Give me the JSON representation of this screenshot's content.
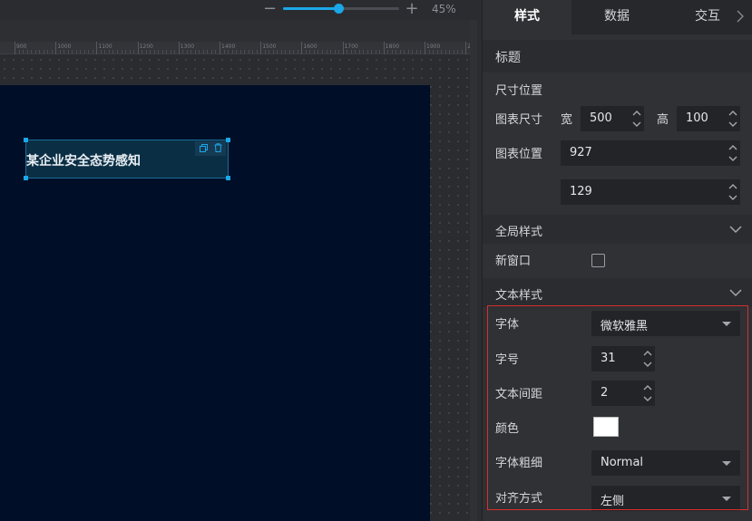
{
  "zoom": {
    "value_label": "45%",
    "percent": 45,
    "minus": "−",
    "plus": "+"
  },
  "ruler": {
    "labels": [
      "900",
      "1000",
      "1100",
      "1200",
      "1300",
      "1400",
      "1500",
      "1600",
      "1700",
      "1800",
      "1900",
      "20"
    ]
  },
  "canvas": {
    "background": "#000f27",
    "component_title": "某企业安全态势感知"
  },
  "tabs": [
    {
      "label": "样式"
    },
    {
      "label": "数据"
    },
    {
      "label": "交互"
    }
  ],
  "sections": {
    "title": "标题",
    "size_position": "尺寸位置",
    "global_style": "全局样式",
    "text_style": "文本样式"
  },
  "size": {
    "label": "图表尺寸",
    "width_label": "宽",
    "width": "500",
    "height_label": "高",
    "height": "100"
  },
  "position": {
    "label": "图表位置",
    "x": "927",
    "y": "129"
  },
  "global": {
    "new_window_label": "新窗口",
    "new_window_checked": false
  },
  "text": {
    "font_label": "字体",
    "font_value": "微软雅黑",
    "size_label": "字号",
    "size_value": "31",
    "spacing_label": "文本间距",
    "spacing_value": "2",
    "color_label": "颜色",
    "color_value": "#ffffff",
    "weight_label": "字体粗细",
    "weight_value": "Normal",
    "align_label": "对齐方式",
    "align_value": "左侧"
  },
  "colors": {
    "accent": "#1ba7e8",
    "highlight_border": "#d9302c"
  }
}
